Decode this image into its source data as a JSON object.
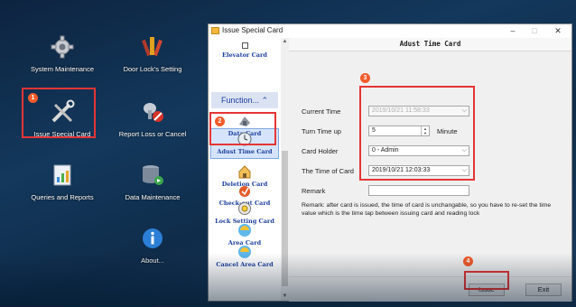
{
  "desktop": {
    "icons": [
      {
        "label": "System Maintenance",
        "icon": "gear-icon"
      },
      {
        "label": "Door Lock's Setting",
        "icon": "wrench-icon"
      },
      {
        "label": "Issue Special Card",
        "icon": "tools-icon"
      },
      {
        "label": "Report Loss or Cancel",
        "icon": "report-loss-icon"
      },
      {
        "label": "Queries and Reports",
        "icon": "reports-icon"
      },
      {
        "label": "Data Maintenance",
        "icon": "database-icon"
      },
      {
        "label": "About...",
        "icon": "info-icon"
      }
    ],
    "badges": [
      "1",
      "2",
      "3",
      "4"
    ],
    "highlight_color": "#e53535"
  },
  "window": {
    "title": "Issue Special Card",
    "min": "–",
    "max": "□",
    "close": "✕"
  },
  "sidebar": {
    "top_item": "Elevator Card",
    "function_header": "Function...",
    "items": [
      {
        "label": "Data Card",
        "icon": "data-card-icon"
      },
      {
        "label": "Adust Time Card",
        "icon": "clock-icon"
      },
      {
        "label": "Deletion Card",
        "icon": "deletion-card-icon"
      },
      {
        "label": "Check-out Card",
        "icon": "checkout-card-icon"
      },
      {
        "label": "Lock Setting Card",
        "icon": "lock-setting-icon"
      },
      {
        "label": "Area Card",
        "icon": "area-card-icon"
      },
      {
        "label": "Cancel Area Card",
        "icon": "cancel-area-card-icon"
      }
    ]
  },
  "panel": {
    "title": "Adust Time Card",
    "current_time_label": "Current Time",
    "current_time_value": "2019/10/21 11:58:33",
    "turn_time_up_label": "Turn Time up",
    "turn_time_up_value": "5",
    "minute_label": "Minute",
    "card_holder_label": "Card Holder",
    "card_holder_value": "0 - Admin",
    "time_of_card_label": "The Time of Card",
    "time_of_card_value": "2019/10/21 12:03:33",
    "remark_label": "Remark",
    "remark_value": "",
    "note": "Remark: after card is issued, the time of card is unchangable, so you have to re-set the time value which is the time tap between issuing card and reading lock",
    "issue_button": "Issue",
    "exit_button": "Exit"
  }
}
